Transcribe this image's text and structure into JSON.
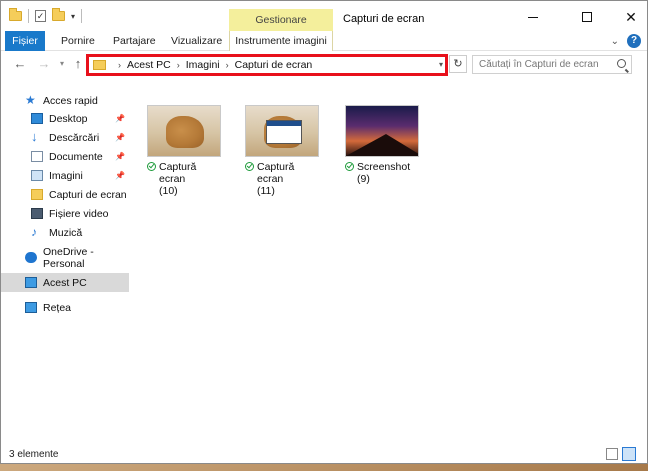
{
  "window": {
    "title": "Capturi de ecran"
  },
  "ribbon": {
    "context_group": "Gestionare",
    "tabs": [
      "Fișier",
      "Pornire",
      "Partajare",
      "Vizualizare",
      "Instrumente imagini"
    ]
  },
  "address": {
    "crumbs": [
      "Acest PC",
      "Imagini",
      "Capturi de ecran"
    ],
    "search_placeholder": "Căutați în Capturi de ecran"
  },
  "nav": {
    "items": [
      {
        "label": "Acces rapid",
        "icon": "star-icon",
        "pinned": false
      },
      {
        "label": "Desktop",
        "icon": "desktop-icon",
        "pinned": true
      },
      {
        "label": "Descărcări",
        "icon": "download-icon",
        "pinned": true
      },
      {
        "label": "Documente",
        "icon": "documents-icon",
        "pinned": true
      },
      {
        "label": "Imagini",
        "icon": "pictures-icon",
        "pinned": true
      },
      {
        "label": "Capturi de ecran",
        "icon": "folder-icon",
        "pinned": false
      },
      {
        "label": "Fișiere video",
        "icon": "videos-icon",
        "pinned": false
      },
      {
        "label": "Muzică",
        "icon": "music-icon",
        "pinned": false
      },
      {
        "label": "OneDrive - Personal",
        "icon": "onedrive-icon",
        "pinned": false
      },
      {
        "label": "Acest PC",
        "icon": "this-pc-icon",
        "pinned": false,
        "selected": true
      },
      {
        "label": "Rețea",
        "icon": "network-icon",
        "pinned": false
      }
    ]
  },
  "files": [
    {
      "name_line1": "Captură ecran",
      "name_line2": "(10)",
      "thumb": "lion"
    },
    {
      "name_line1": "Captură ecran",
      "name_line2": "(11)",
      "thumb": "lion-dialog"
    },
    {
      "name_line1": "Screenshot (9)",
      "name_line2": "",
      "thumb": "night-sky"
    }
  ],
  "status": {
    "count": "3 elemente"
  }
}
